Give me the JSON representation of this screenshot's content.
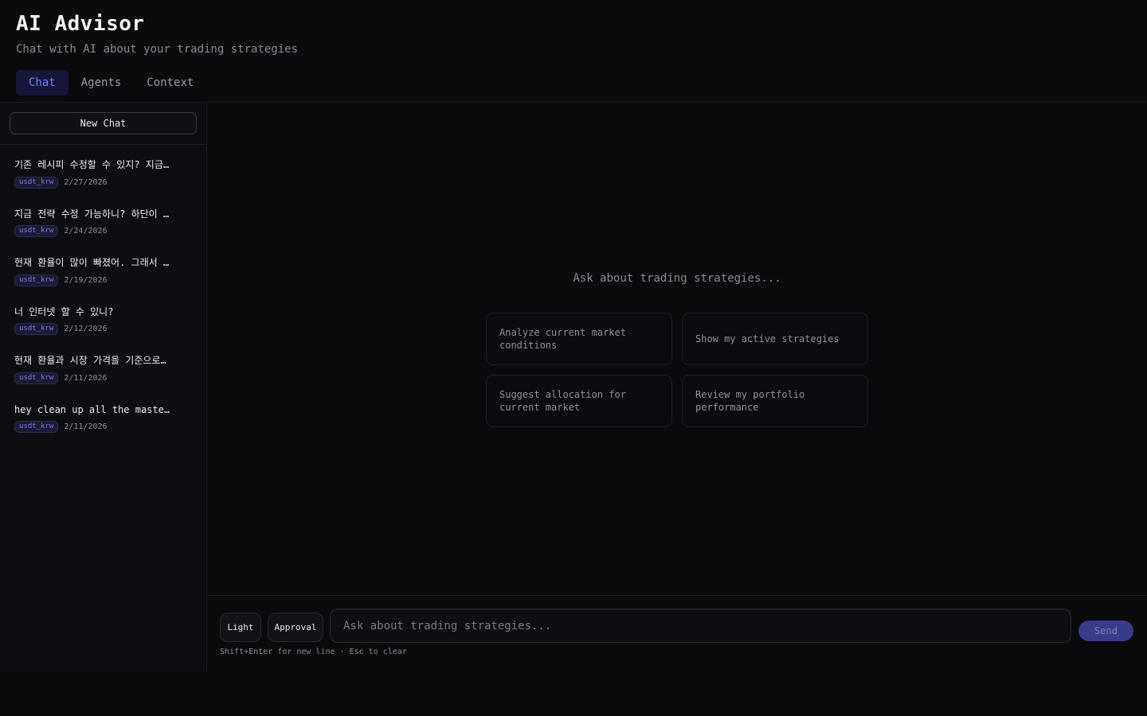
{
  "header": {
    "title": "AI Advisor",
    "subtitle": "Chat with AI about your trading strategies",
    "tabs": [
      {
        "label": "Chat",
        "active": true
      },
      {
        "label": "Agents",
        "active": false
      },
      {
        "label": "Context",
        "active": false
      }
    ]
  },
  "sidebar": {
    "new_chat_label": "New Chat",
    "history": [
      {
        "title": "기존 레시피 수정할 수 있지? 지금 …",
        "tag": "usdt_krw",
        "date": "2/27/2026"
      },
      {
        "title": "지금 전략 수정 가능하니? 하단이 …",
        "tag": "usdt_krw",
        "date": "2/24/2026"
      },
      {
        "title": "현재 환율이 많이 빠졌어. 그래서 …",
        "tag": "usdt_krw",
        "date": "2/19/2026"
      },
      {
        "title": "너 인터넷 할 수 있니?",
        "tag": "usdt_krw",
        "date": "2/12/2026"
      },
      {
        "title": "현재 환율과 시장 가격을 기준으로,…",
        "tag": "usdt_krw",
        "date": "2/11/2026"
      },
      {
        "title": "hey clean up all the maste…",
        "tag": "usdt_krw",
        "date": "2/11/2026"
      }
    ]
  },
  "main": {
    "empty_prompt": "Ask about trading strategies...",
    "suggestions": [
      "Analyze current market conditions",
      "Show my active strategies",
      "Suggest allocation for current market",
      "Review my portfolio performance"
    ]
  },
  "composer": {
    "mode_light": "Light",
    "mode_approval": "Approval",
    "placeholder": "Ask about trading strategies...",
    "send_label": "Send",
    "hint": "Shift+Enter for new line · Esc to clear"
  },
  "colors": {
    "background": "#0b0a0d",
    "accent": "#7c7cf0",
    "send_button": "#3a3a8a"
  }
}
